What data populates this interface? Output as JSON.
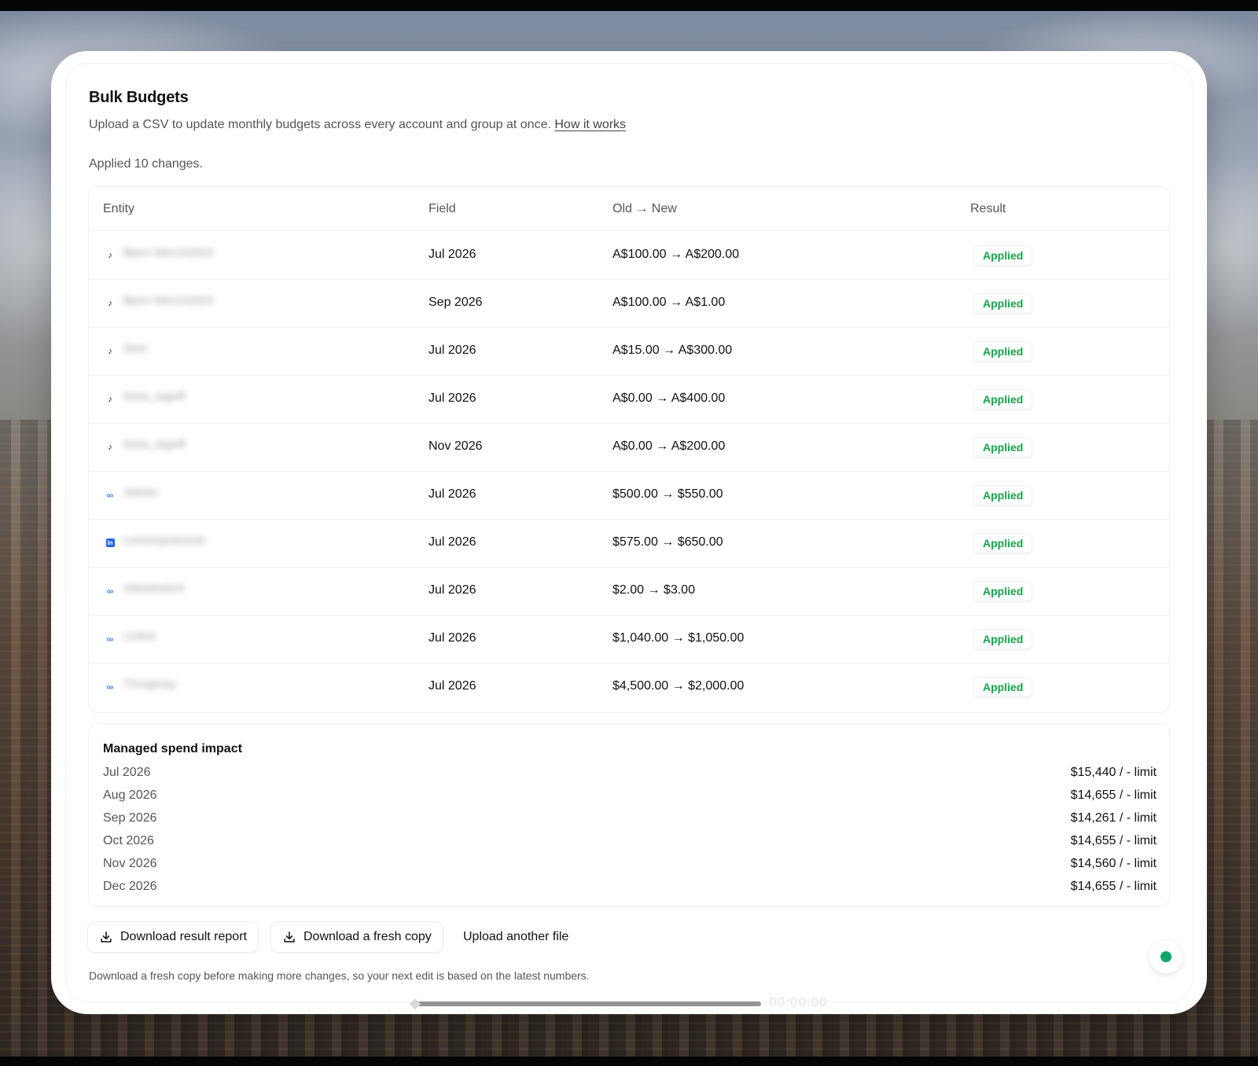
{
  "page": {
    "title": "Bulk Budgets",
    "subtitle": "Upload a CSV to update monthly budgets across every account and group at once.",
    "how_it_works_link": "How it works",
    "status": "Applied 10 changes."
  },
  "table": {
    "headers": {
      "entity": "Entity",
      "field": "Field",
      "change": "Old → New",
      "result": "Result"
    },
    "rows": [
      {
        "platform": "tiktok",
        "icon": "tiktok-icon",
        "entity": "Bjorn Merch2024",
        "field": "Jul 2026",
        "change": "A$100.00 → A$200.00",
        "result": "Applied"
      },
      {
        "platform": "tiktok",
        "icon": "tiktok-icon",
        "entity": "Bjorn Merch2024",
        "field": "Sep 2026",
        "change": "A$100.00 → A$1.00",
        "result": "Applied"
      },
      {
        "platform": "tiktok",
        "icon": "tiktok-icon",
        "entity": "Dion",
        "field": "Jul 2026",
        "change": "A$15.00 → A$300.00",
        "result": "Applied"
      },
      {
        "platform": "tiktok",
        "icon": "tiktok-icon",
        "entity": "Nora_tagoff",
        "field": "Jul 2026",
        "change": "A$0.00 → A$400.00",
        "result": "Applied"
      },
      {
        "platform": "tiktok",
        "icon": "tiktok-icon",
        "entity": "Nora_tagoff",
        "field": "Nov 2026",
        "change": "A$0.00 → A$200.00",
        "result": "Applied"
      },
      {
        "platform": "meta",
        "icon": "meta-icon",
        "entity": "Aleeta",
        "field": "Jul 2026",
        "change": "$500.00 → $550.00",
        "result": "Applied"
      },
      {
        "platform": "linkedin",
        "icon": "linkedin-icon",
        "entity": "Lemongrassnet",
        "field": "Jul 2026",
        "change": "$575.00 → $650.00",
        "result": "Applied"
      },
      {
        "platform": "meta",
        "icon": "meta-icon",
        "entity": "Abbottsford",
        "field": "Jul 2026",
        "change": "$2.00 → $3.00",
        "result": "Applied"
      },
      {
        "platform": "meta",
        "icon": "meta-icon",
        "entity": "Linfort",
        "field": "Jul 2026",
        "change": "$1,040.00 → $1,050.00",
        "result": "Applied"
      },
      {
        "platform": "meta",
        "icon": "meta-icon",
        "entity": "Throgmay",
        "field": "Jul 2026",
        "change": "$4,500.00 → $2,000.00",
        "result": "Applied"
      }
    ]
  },
  "impact": {
    "title": "Managed spend impact",
    "rows": [
      {
        "month": "Jul 2026",
        "value": "$15,440 / - limit"
      },
      {
        "month": "Aug 2026",
        "value": "$14,655 / - limit"
      },
      {
        "month": "Sep 2026",
        "value": "$14,261 / - limit"
      },
      {
        "month": "Oct 2026",
        "value": "$14,655 / - limit"
      },
      {
        "month": "Nov 2026",
        "value": "$14,560 / - limit"
      },
      {
        "month": "Dec 2026",
        "value": "$14,655 / - limit"
      }
    ]
  },
  "actions": {
    "download_report": "Download result report",
    "download_copy": "Download a fresh copy",
    "upload_another": "Upload another file",
    "download_icon": "download-icon"
  },
  "footnote": "Download a fresh copy before making more changes, so your next edit is based on the latest numbers.",
  "player": {
    "timecode": "00:00:00"
  },
  "colors": {
    "success": "#16a34a",
    "chat_dot": "#12a56b",
    "meta": "#3b82f6",
    "linkedin": "#2563eb"
  }
}
